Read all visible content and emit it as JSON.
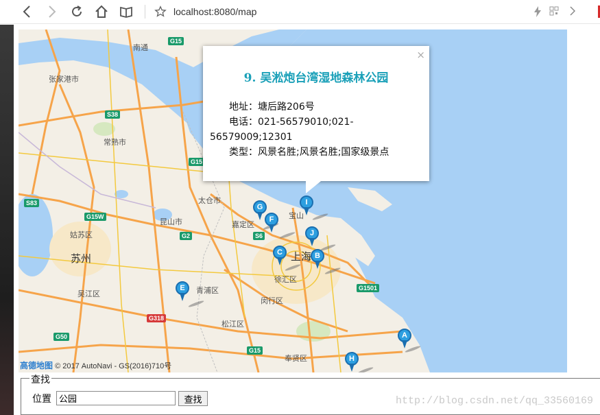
{
  "browser": {
    "url": "localhost:8080/map"
  },
  "map": {
    "places": [
      {
        "id": "nantong",
        "name": "南通"
      },
      {
        "id": "zhangjiagang",
        "name": "张家港市"
      },
      {
        "id": "changshu",
        "name": "常熟市"
      },
      {
        "id": "taicang",
        "name": "太仓市"
      },
      {
        "id": "kunshan",
        "name": "昆山市"
      },
      {
        "id": "jiading",
        "name": "嘉定区"
      },
      {
        "id": "baoshan",
        "name": "宝山"
      },
      {
        "id": "gusu",
        "name": "姑苏区"
      },
      {
        "id": "suzhou",
        "name": "苏州"
      },
      {
        "id": "shanghai",
        "name": "上海"
      },
      {
        "id": "xuhui",
        "name": "徐汇区"
      },
      {
        "id": "wujiang",
        "name": "吴江区"
      },
      {
        "id": "qingpu",
        "name": "青浦区"
      },
      {
        "id": "minhang",
        "name": "闵行区"
      },
      {
        "id": "songjiang",
        "name": "松江区"
      },
      {
        "id": "fengxian",
        "name": "奉贤区"
      }
    ],
    "shields": [
      {
        "id": "g15a",
        "label": "G15",
        "color": "green"
      },
      {
        "id": "s38",
        "label": "S38",
        "color": "green"
      },
      {
        "id": "g15b",
        "label": "G15",
        "color": "green"
      },
      {
        "id": "s83",
        "label": "S83",
        "color": "green"
      },
      {
        "id": "g15w",
        "label": "G15W",
        "color": "green"
      },
      {
        "id": "g2",
        "label": "G2",
        "color": "green"
      },
      {
        "id": "s6",
        "label": "S6",
        "color": "green"
      },
      {
        "id": "g1501",
        "label": "G1501",
        "color": "green"
      },
      {
        "id": "g318",
        "label": "G318",
        "color": "red"
      },
      {
        "id": "g50",
        "label": "G50",
        "color": "green"
      },
      {
        "id": "g15c",
        "label": "G15",
        "color": "green"
      }
    ],
    "markers": [
      "A",
      "B",
      "C",
      "E",
      "F",
      "G",
      "H",
      "I",
      "J"
    ],
    "copyright_logo": "高德地图",
    "copyright_text": "© 2017 AutoNavi - GS(2016)710号"
  },
  "infowindow": {
    "close": "×",
    "title": "9.  吴淞炮台湾湿地森林公园",
    "address": "地址：塘后路206号",
    "phone": "电话：021-56579010;021-56579009;12301",
    "type": "类型：风景名胜;风景名胜;国家级景点"
  },
  "search": {
    "legend": "查找",
    "label": "位置",
    "value": "公园",
    "button": "查找"
  },
  "watermark": "http://blog.csdn.net/qq_33560169"
}
